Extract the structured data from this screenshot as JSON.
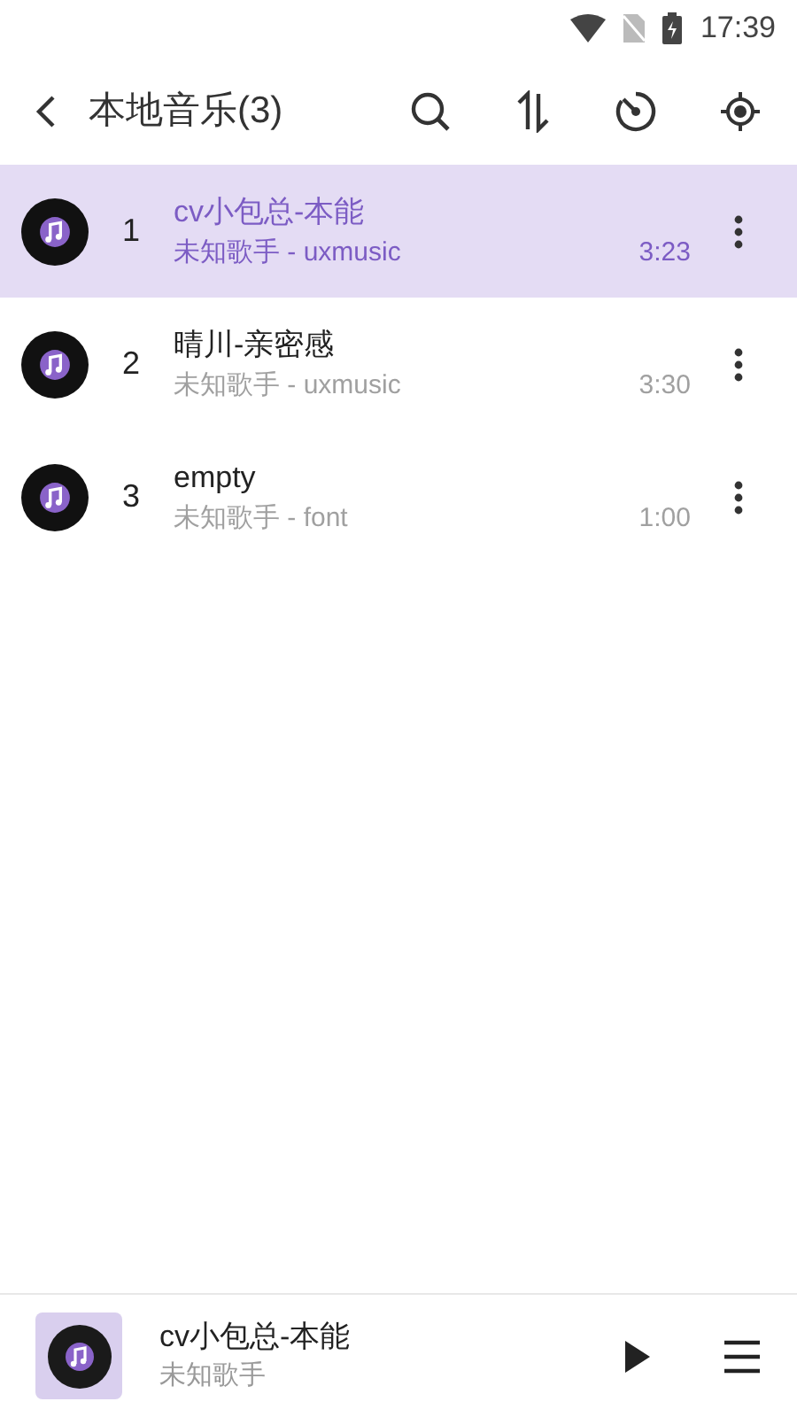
{
  "status_bar": {
    "time": "17:39"
  },
  "toolbar": {
    "title": "本地音乐(3)"
  },
  "songs": [
    {
      "index": "1",
      "title": "cv小包总-本能",
      "subtitle": "未知歌手 - uxmusic",
      "duration": "3:23",
      "selected": true
    },
    {
      "index": "2",
      "title": "晴川-亲密感",
      "subtitle": "未知歌手 - uxmusic",
      "duration": "3:30",
      "selected": false
    },
    {
      "index": "3",
      "title": "empty",
      "subtitle": "未知歌手 - font",
      "duration": "1:00",
      "selected": false
    }
  ],
  "now_playing": {
    "title": "cv小包总-本能",
    "artist": "未知歌手"
  }
}
